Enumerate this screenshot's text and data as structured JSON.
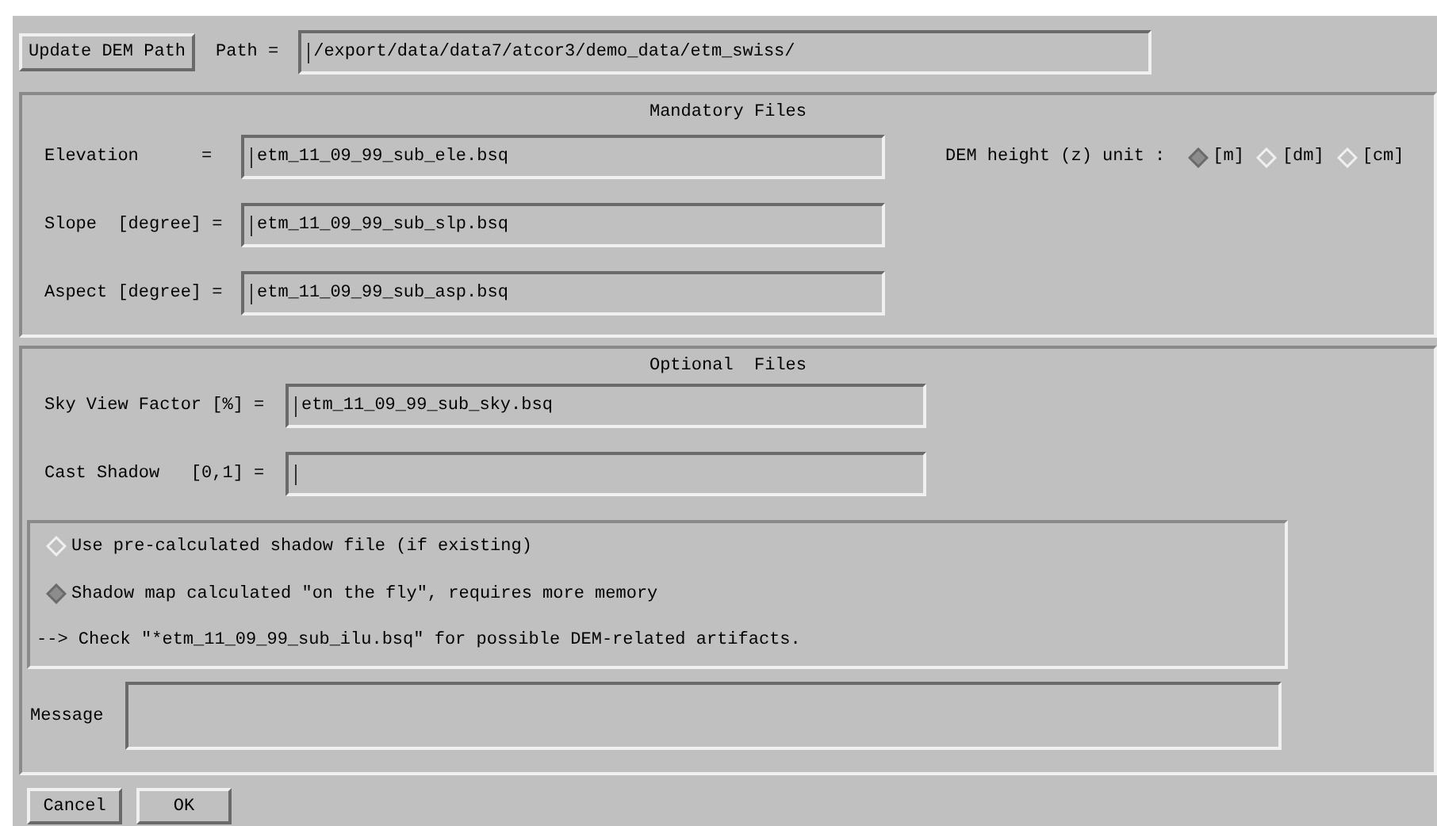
{
  "top": {
    "button": "Update DEM Path",
    "path_label": "Path =",
    "path_value": "/export/data/data7/atcor3/demo_data/etm_swiss/"
  },
  "mandatory": {
    "title": "Mandatory Files",
    "fields": [
      {
        "label": "Elevation      =",
        "value": "etm_11_09_99_sub_ele.bsq"
      },
      {
        "label": "Slope  [degree] =",
        "value": "etm_11_09_99_sub_slp.bsq"
      },
      {
        "label": "Aspect [degree] =",
        "value": "etm_11_09_99_sub_asp.bsq"
      }
    ],
    "unit_label": "DEM height (z) unit :",
    "units": [
      {
        "label": "[m]",
        "selected": true
      },
      {
        "label": "[dm]",
        "selected": false
      },
      {
        "label": "[cm]",
        "selected": false
      }
    ]
  },
  "optional": {
    "title": "Optional  Files",
    "fields": [
      {
        "label": "Sky View Factor [%] =",
        "value": "etm_11_09_99_sub_sky.bsq"
      },
      {
        "label": "Cast Shadow   [0,1] ="
      }
    ],
    "shadow_options": [
      {
        "label": "Use pre-calculated shadow file (if existing)",
        "selected": false
      },
      {
        "label": "Shadow map calculated \"on the fly\", requires more memory",
        "selected": true
      }
    ],
    "note": "--> Check \"*etm_11_09_99_sub_ilu.bsq\" for possible DEM-related artifacts.",
    "message_label": "Message"
  },
  "buttons": [
    "Cancel",
    "OK"
  ]
}
